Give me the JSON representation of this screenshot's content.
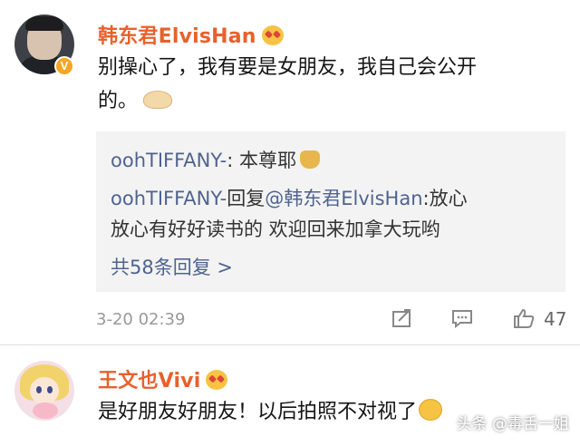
{
  "comment1": {
    "username": "韩东君ElvisHan",
    "badge": "V",
    "text_line1": "别操心了，我有要是女朋友，我自己会公开",
    "text_line2": "的。",
    "reply1_user": "oohTIFFANY-",
    "reply1_text": ": 本尊耶",
    "reply2_user": "oohTIFFANY-",
    "reply2_action": "回复",
    "reply2_target": "@韩东君ElvisHan",
    "reply2_text": ":放心",
    "reply2_text2": "放心有好好读书的 欢迎回来加拿大玩哟",
    "more_replies": "共58条回复 >",
    "timestamp": "3-20 02:39",
    "like_count": "47"
  },
  "comment2": {
    "username": "王文也Vivi",
    "text": "是好朋友好朋友！以后拍照不对视了"
  },
  "watermark": "头条 @毒舌一姐",
  "colors": {
    "username": "#e8612c",
    "link_blue": "#50638f",
    "reply_bg": "#f3f3f3",
    "meta_gray": "#999999"
  }
}
